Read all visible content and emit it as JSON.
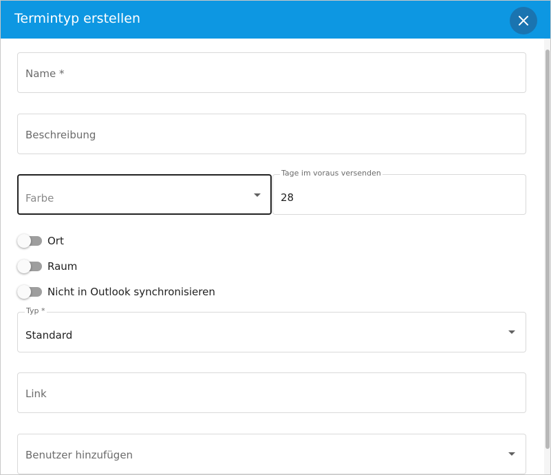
{
  "dialog": {
    "title": "Termintyp erstellen",
    "accent_color": "#0d97e2"
  },
  "form": {
    "name": {
      "placeholder": "Name *"
    },
    "beschreibung": {
      "placeholder": "Beschreibung"
    },
    "farbe": {
      "placeholder": "Farbe"
    },
    "tage": {
      "label": "Tage im voraus versenden",
      "value": "28"
    },
    "toggles": [
      {
        "label": "Ort",
        "checked": false
      },
      {
        "label": "Raum",
        "checked": false
      },
      {
        "label": "Nicht in Outlook synchronisieren",
        "checked": false
      }
    ],
    "typ": {
      "label": "Typ *",
      "value": "Standard"
    },
    "link": {
      "placeholder": "Link"
    },
    "benutzer": {
      "placeholder": "Benutzer hinzufügen"
    }
  },
  "icons": {
    "close": "close-icon",
    "dropdown": "caret-down-icon"
  }
}
